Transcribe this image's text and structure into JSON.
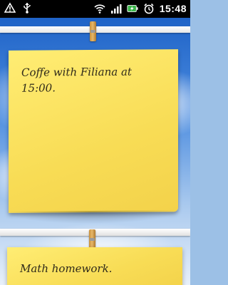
{
  "status_bar": {
    "time": "15:48",
    "icons": [
      "warning-icon",
      "usb-icon",
      "wifi-icon",
      "signal-icon",
      "battery-charging-icon",
      "alarm-icon"
    ]
  },
  "notes": [
    {
      "text": "Coffe with Filiana at 15:00."
    },
    {
      "text": "Math homework."
    }
  ],
  "colors": {
    "note_yellow": "#f8dc55",
    "text": "#2f2a1a",
    "battery_green": "#3bb54a"
  }
}
